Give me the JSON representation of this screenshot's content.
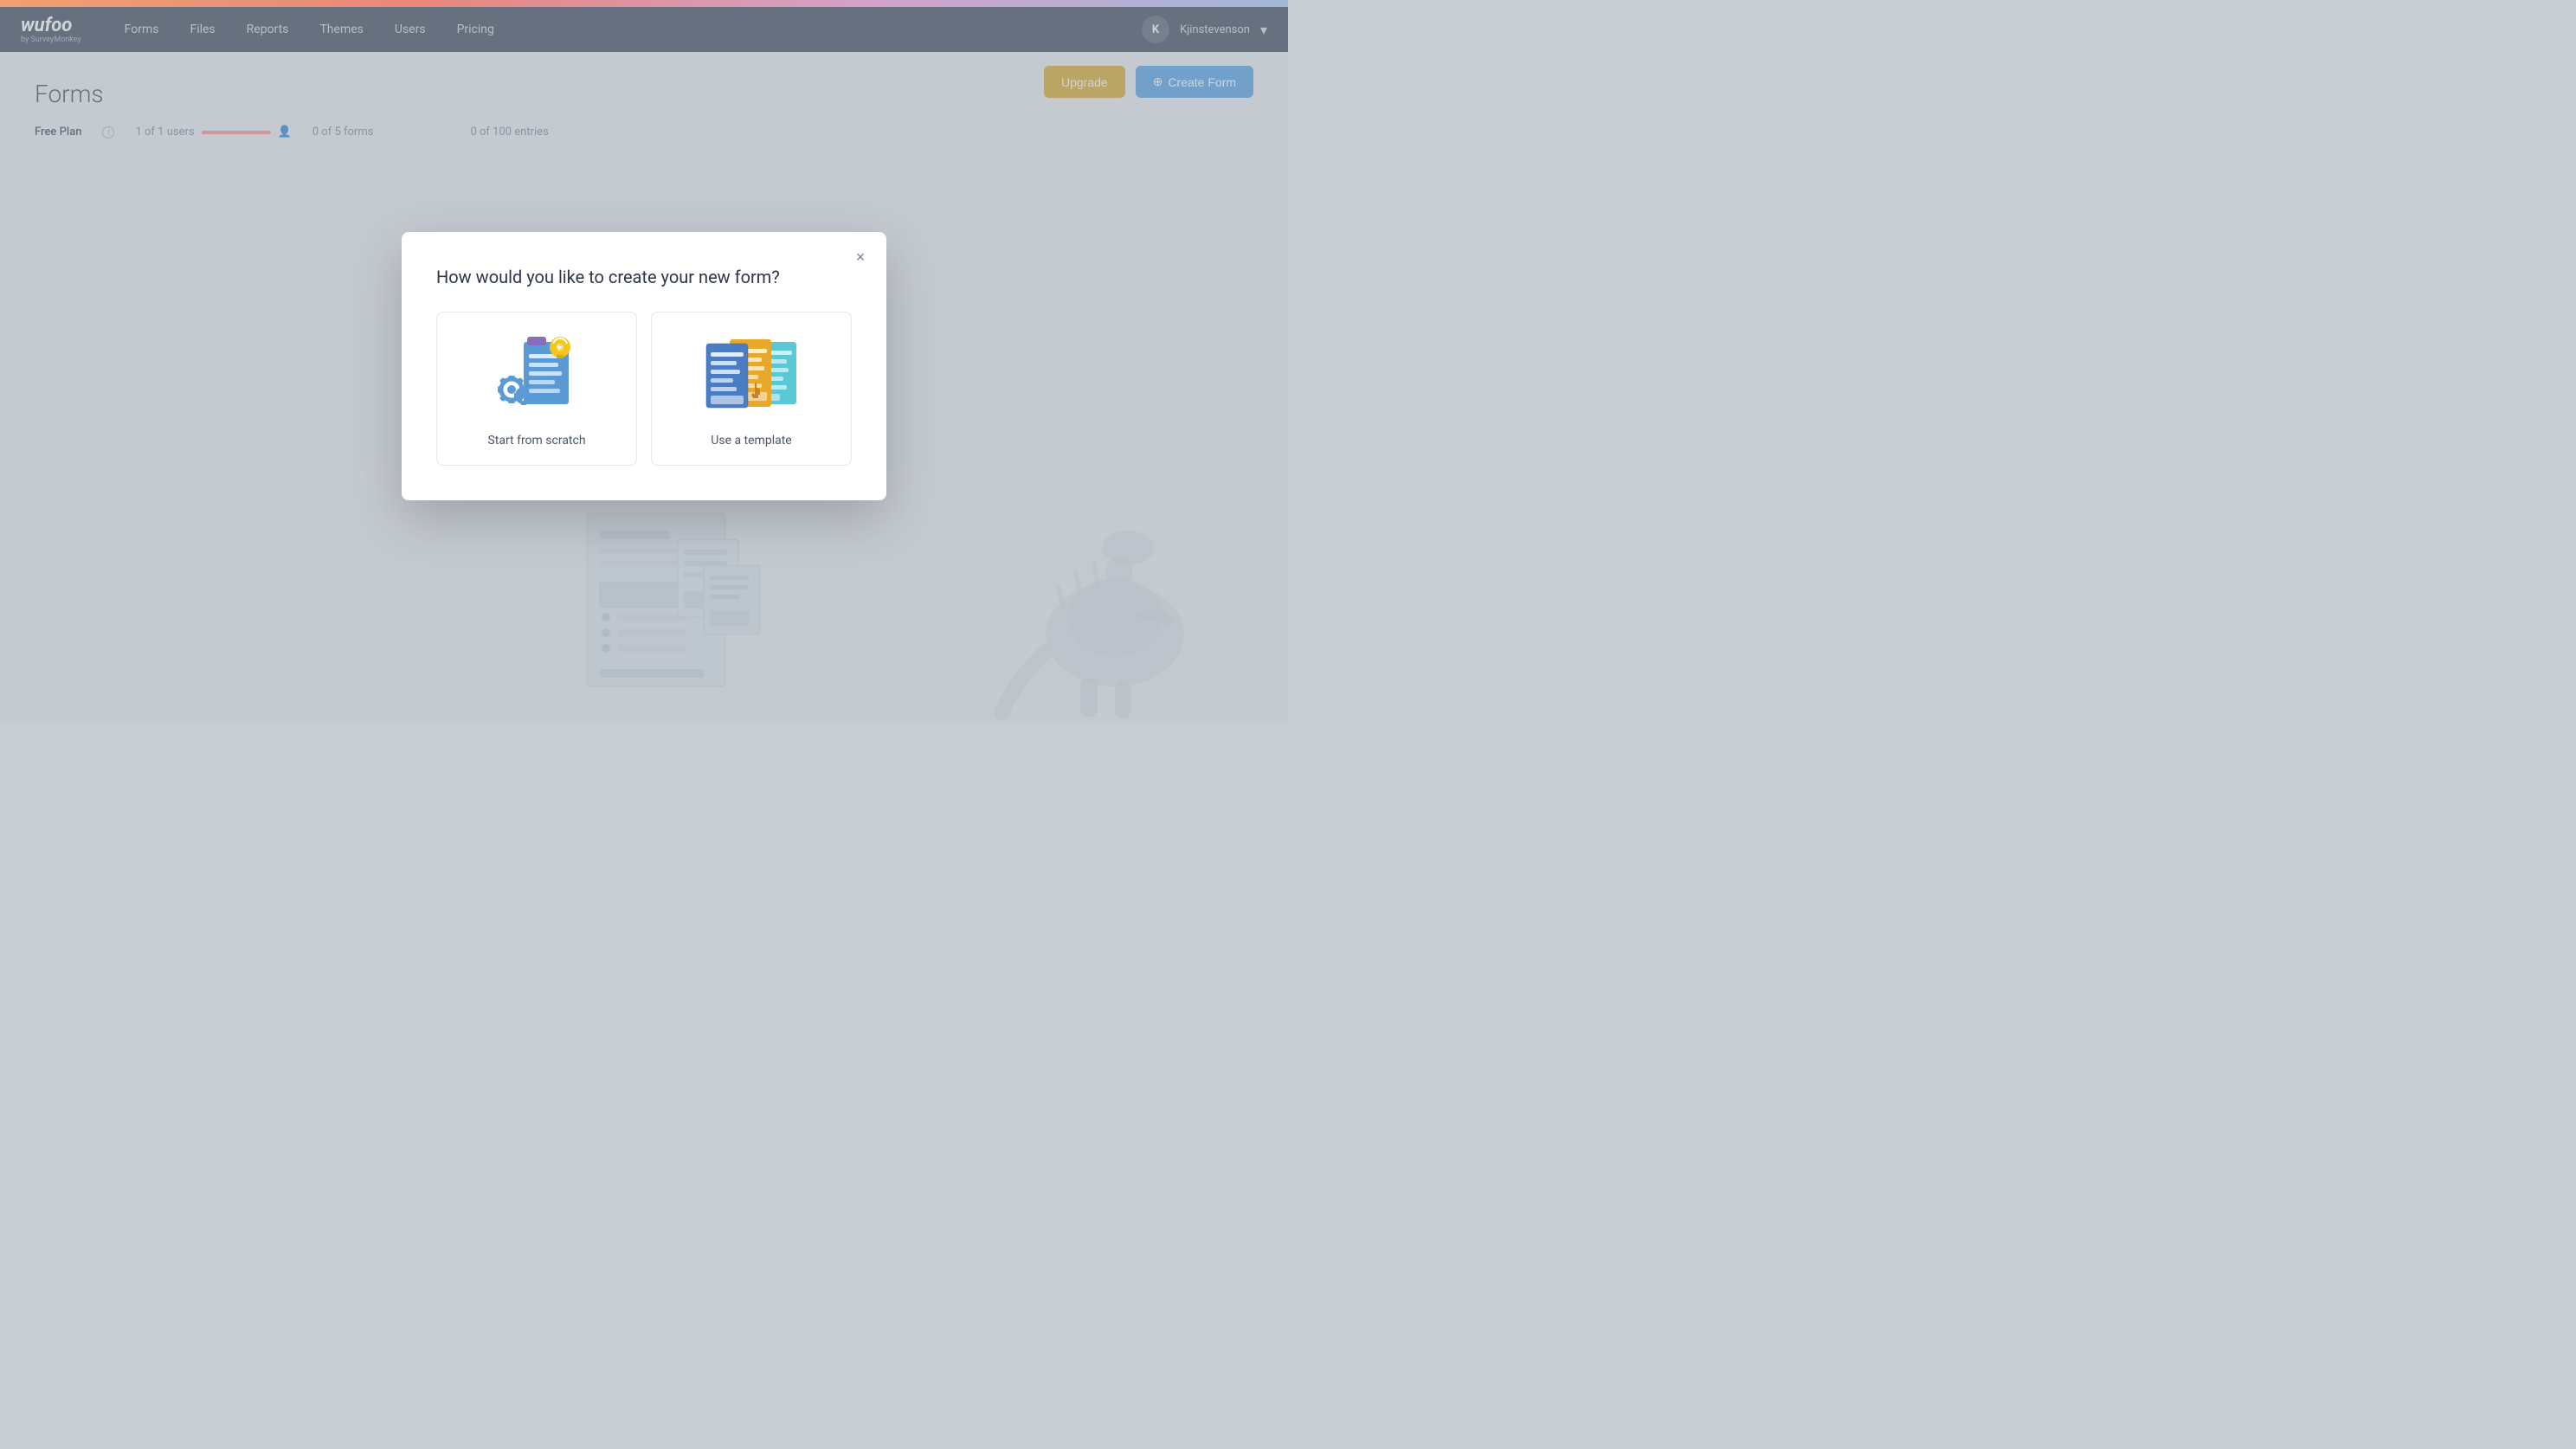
{
  "topbar": {
    "gradient": "linear-gradient coral to purple-blue"
  },
  "navbar": {
    "logo": "wufoo",
    "logo_sub": "by SurveyMonkey",
    "links": [
      "Forms",
      "Files",
      "Reports",
      "Themes",
      "Users",
      "Pricing"
    ],
    "user_initial": "K",
    "user_name": "Kjinstevenson",
    "dropdown_icon": "▾"
  },
  "page": {
    "title": "Forms",
    "plan_label": "Free Plan",
    "stats": [
      {
        "label": "1 of 1 users",
        "fill_pct": 100
      },
      {
        "label": "0 of 5 forms",
        "fill_pct": 0
      },
      {
        "label": "0 of 100 entries",
        "fill_pct": 0
      }
    ],
    "upgrade_btn": "Upgrade",
    "create_btn": "Create Form",
    "create_icon": "+"
  },
  "modal": {
    "title": "How would you like to create your new form?",
    "close_label": "×",
    "option_scratch_label": "Start from scratch",
    "option_template_label": "Use a template"
  }
}
